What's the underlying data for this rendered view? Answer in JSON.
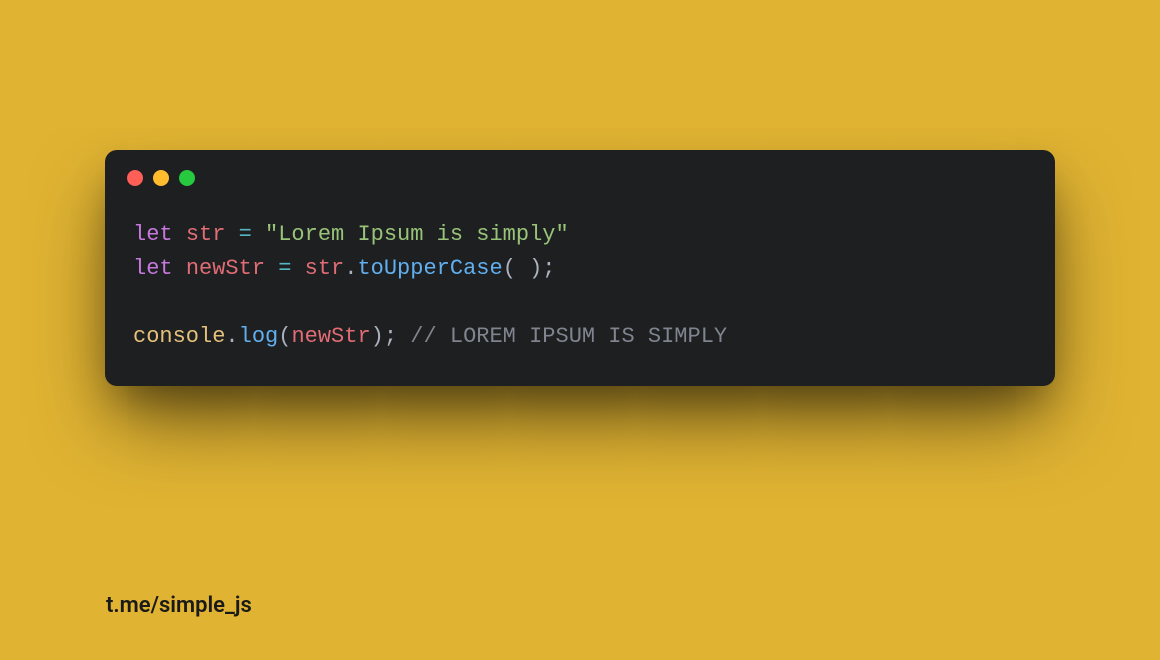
{
  "window": {
    "traffic_lights": [
      "close",
      "minimize",
      "zoom"
    ]
  },
  "code": {
    "lines": [
      [
        {
          "cls": "tok-keyword",
          "t": "let"
        },
        {
          "cls": "",
          "t": " "
        },
        {
          "cls": "tok-var",
          "t": "str"
        },
        {
          "cls": "",
          "t": " "
        },
        {
          "cls": "tok-op",
          "t": "="
        },
        {
          "cls": "",
          "t": " "
        },
        {
          "cls": "tok-string",
          "t": "\"Lorem Ipsum is simply\""
        }
      ],
      [
        {
          "cls": "tok-keyword",
          "t": "let"
        },
        {
          "cls": "",
          "t": " "
        },
        {
          "cls": "tok-var",
          "t": "newStr"
        },
        {
          "cls": "",
          "t": " "
        },
        {
          "cls": "tok-op",
          "t": "="
        },
        {
          "cls": "",
          "t": " "
        },
        {
          "cls": "tok-var",
          "t": "str"
        },
        {
          "cls": "tok-punct",
          "t": "."
        },
        {
          "cls": "tok-method",
          "t": "toUpperCase"
        },
        {
          "cls": "tok-punct",
          "t": "( );"
        }
      ],
      [],
      [
        {
          "cls": "tok-obj",
          "t": "console"
        },
        {
          "cls": "tok-punct",
          "t": "."
        },
        {
          "cls": "tok-method",
          "t": "log"
        },
        {
          "cls": "tok-punct",
          "t": "("
        },
        {
          "cls": "tok-var",
          "t": "newStr"
        },
        {
          "cls": "tok-punct",
          "t": ");"
        },
        {
          "cls": "",
          "t": " "
        },
        {
          "cls": "tok-comment",
          "t": "// LOREM IPSUM IS SIMPLY"
        }
      ]
    ]
  },
  "footer": {
    "link": "t.me/simple_js"
  }
}
